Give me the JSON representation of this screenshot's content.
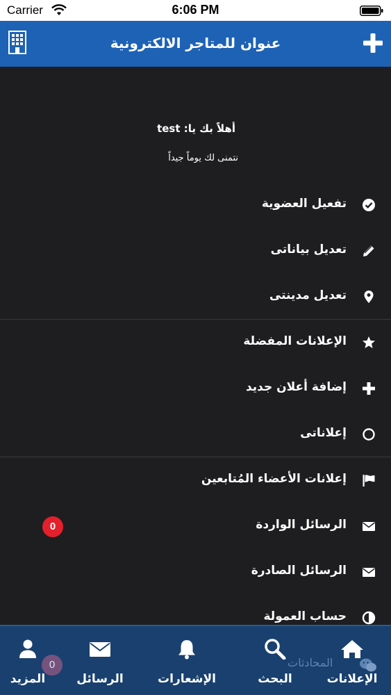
{
  "status_bar": {
    "carrier": "Carrier",
    "time": "6:06 PM"
  },
  "nav": {
    "title": "عنوان للمتاجر الالكترونية",
    "left_icon": "building-icon",
    "right_icon": "plus-icon"
  },
  "greeting": {
    "welcome": "أهلاً بك يا: test",
    "wish": "نتمنى لك يوماً جيداً"
  },
  "menu": {
    "items": [
      {
        "label": "تفعيل العضوية",
        "icon": "check-circle-icon"
      },
      {
        "label": "تعديل بياناتى",
        "icon": "pencil-icon"
      },
      {
        "label": "تعديل مدينتى",
        "icon": "map-marker-icon"
      },
      {
        "label": "الإعلانات المفضلة",
        "icon": "star-icon"
      },
      {
        "label": "إضافة أعلان جديد",
        "icon": "plus-icon"
      },
      {
        "label": "إعلاناتى",
        "icon": "circle-icon"
      },
      {
        "label": "إعلانات الأعضاء المُتابعين",
        "icon": "flag-icon"
      },
      {
        "label": "الرسائل الواردة",
        "icon": "envelope-icon",
        "badge": "0"
      },
      {
        "label": "الرسائل الصادرة",
        "icon": "envelope-icon"
      },
      {
        "label": "حساب العمولة",
        "icon": "half-circle-icon"
      }
    ]
  },
  "tabs": {
    "items": [
      {
        "label": "الإعلانات",
        "icon": "home-icon"
      },
      {
        "label": "البحث",
        "icon": "search-icon"
      },
      {
        "label": "الإشعارات",
        "icon": "bell-icon"
      },
      {
        "label": "الرسائل",
        "icon": "envelope-icon"
      },
      {
        "label": "المزيد",
        "icon": "user-icon"
      }
    ],
    "chat_overlay": "المحادثات",
    "more_badge": "0"
  },
  "colors": {
    "nav": "#1e62b5",
    "background": "#1e1e20",
    "tabbar": "#19406f",
    "badge": "#e3202b"
  }
}
